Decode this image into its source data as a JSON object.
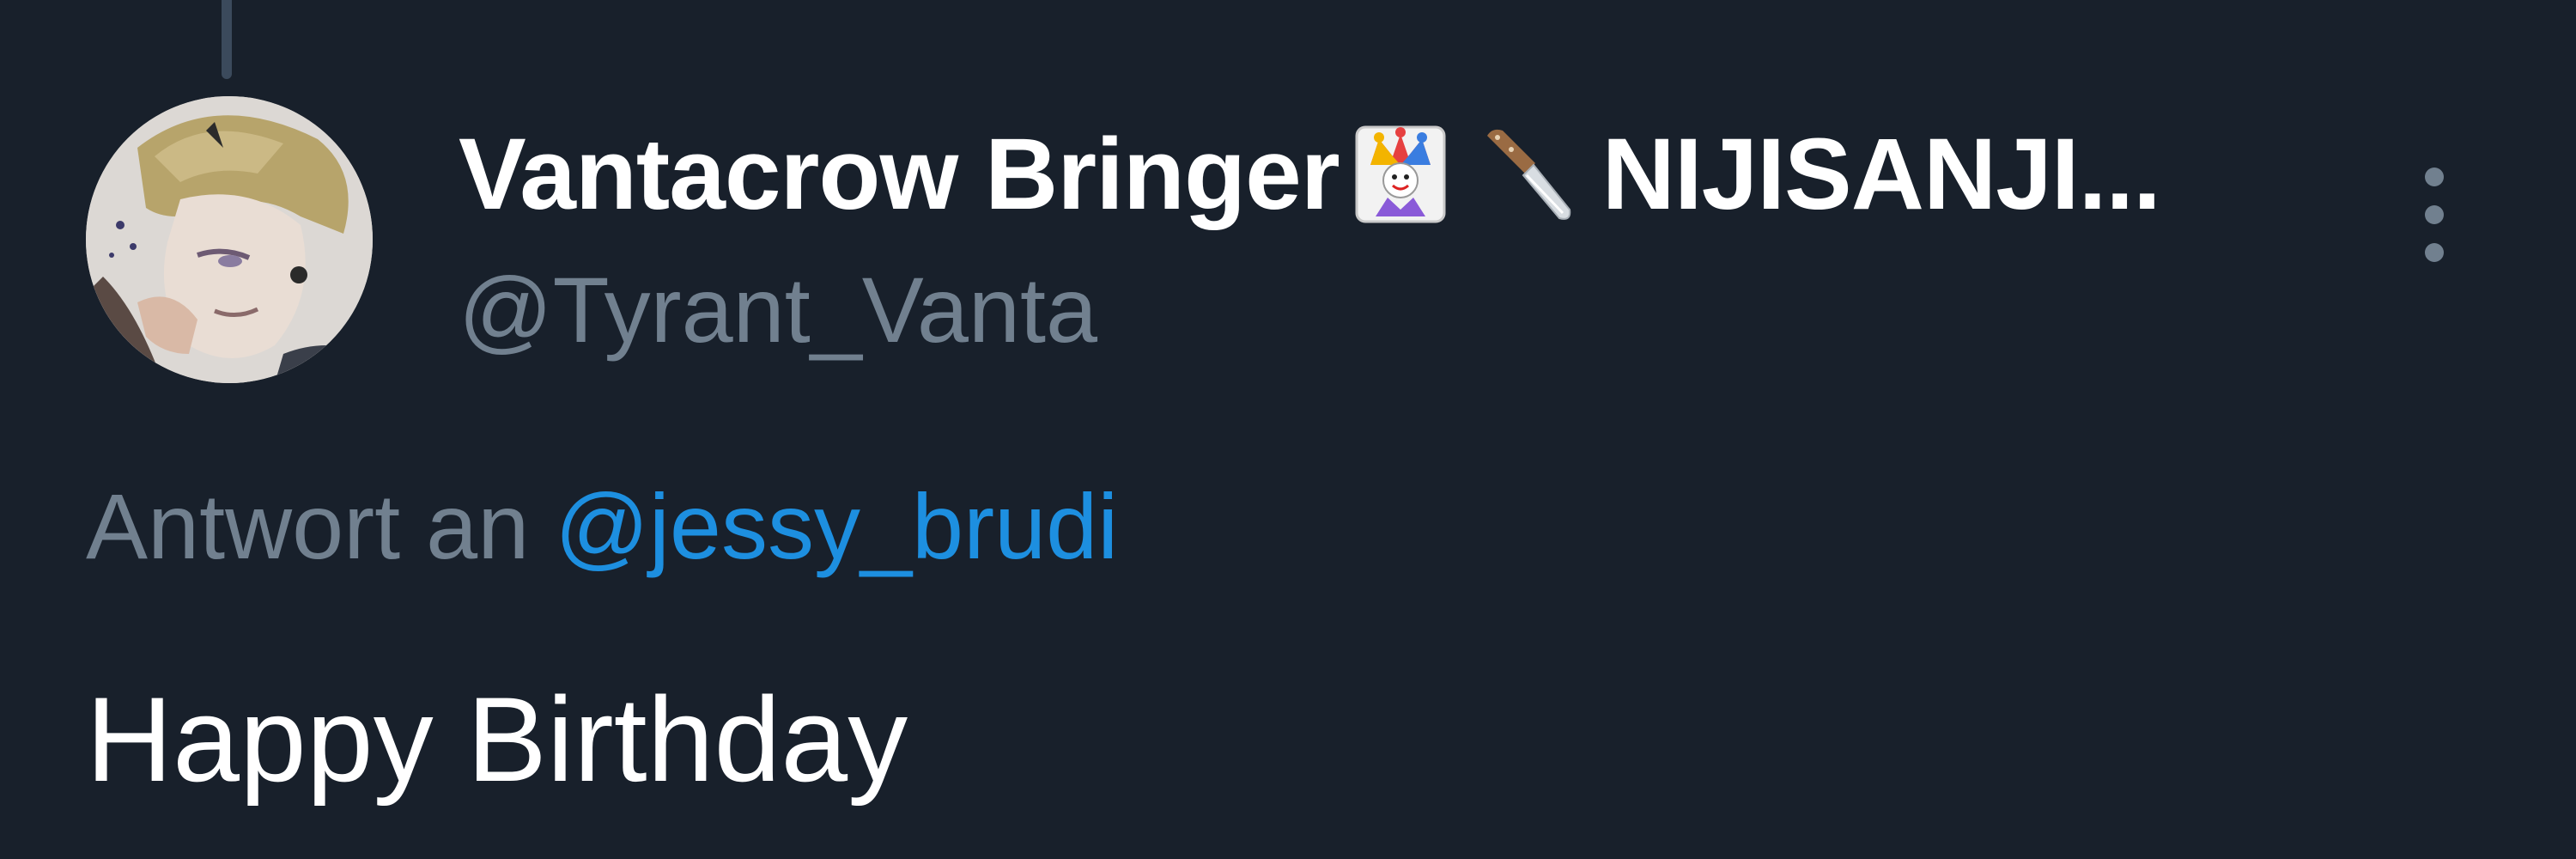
{
  "thread": {
    "connector": "thread-line"
  },
  "author": {
    "display_name": "Vantacrow Bringer",
    "name_emojis": [
      "joker-card-emoji",
      "kitchen-knife-emoji"
    ],
    "name_suffix": "NIJISANJI...",
    "handle": "@Tyrant_Vanta",
    "avatar": "avatar-illustration"
  },
  "menu": {
    "icon": "more-vertical-icon"
  },
  "reply": {
    "prefix": "Antwort an",
    "mention": "@jessy_brudi"
  },
  "tweet": {
    "text": "Happy Birthday"
  },
  "colors": {
    "background": "#18202b",
    "primary_text": "#ffffff",
    "secondary_text": "#71808f",
    "link": "#1d8fe0",
    "thread_line": "#3b4a5c"
  }
}
